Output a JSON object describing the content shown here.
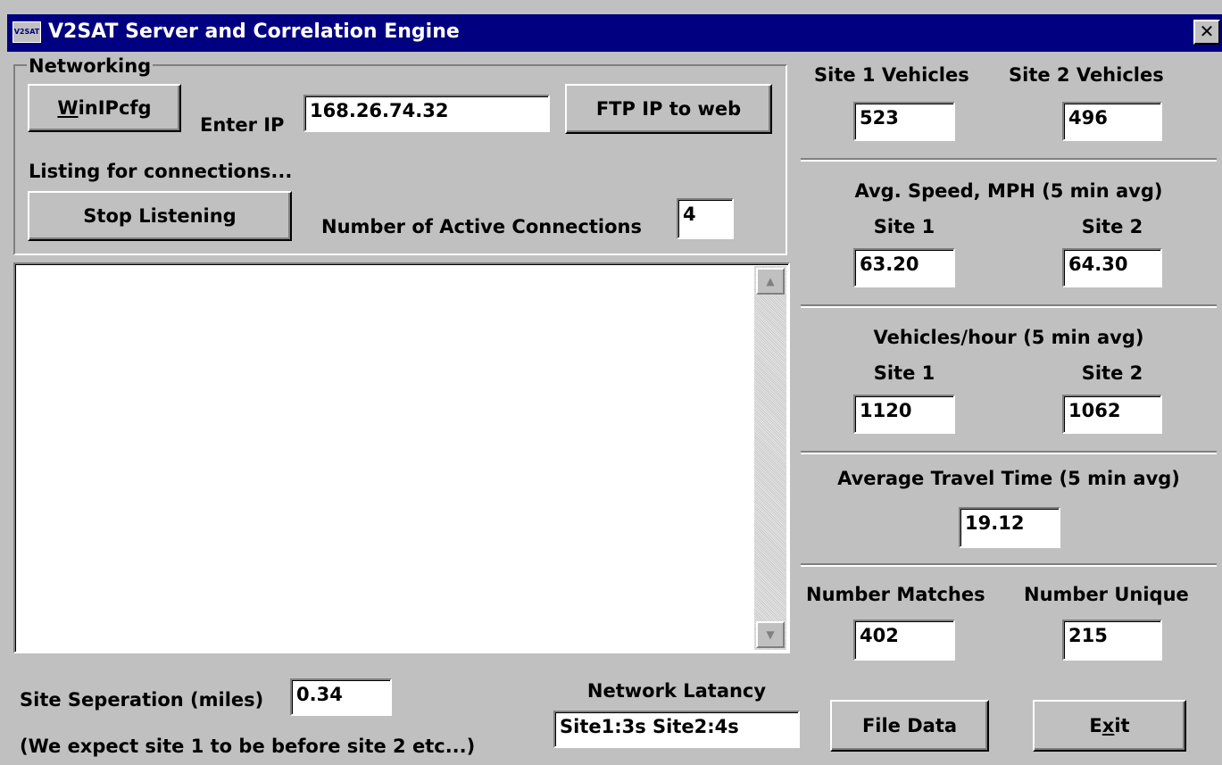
{
  "window": {
    "title": "V2SAT Server and Correlation Engine",
    "icon_label": "V2SAT",
    "close_glyph": "✕"
  },
  "networking": {
    "group_label": "Networking",
    "winipcfg_button": {
      "prefix": "",
      "mnemonic": "W",
      "suffix": "inIPcfg"
    },
    "enter_ip_label": "Enter IP",
    "ip_value": "168.26.74.32",
    "ftp_button": "FTP IP to web",
    "status_text": "Listing for connections...",
    "stop_button": "Stop Listening",
    "active_connections_label": "Number of Active Connections",
    "active_connections_value": "4"
  },
  "log": {
    "lines": []
  },
  "scrollbar": {
    "up_glyph": "▲",
    "down_glyph": "▼"
  },
  "footer": {
    "site_separation_label": "Site Seperation (miles)",
    "site_separation_value": "0.34",
    "site_order_note": "(We expect site 1 to be before site 2 etc...)",
    "network_latency_label": "Network Latancy",
    "network_latency_value": "Site1:3s Site2:4s",
    "file_data_button": "File Data",
    "exit_button": {
      "prefix": "E",
      "mnemonic": "x",
      "suffix": "it"
    }
  },
  "stats": {
    "site1_vehicles_label": "Site 1 Vehicles",
    "site2_vehicles_label": "Site 2 Vehicles",
    "site1_vehicles": "523",
    "site2_vehicles": "496",
    "avg_speed_label": "Avg. Speed, MPH (5 min avg)",
    "site1_label": "Site 1",
    "site2_label": "Site 2",
    "site1_speed": "63.20",
    "site2_speed": "64.30",
    "vph_label": "Vehicles/hour (5 min avg)",
    "site1_vph": "1120",
    "site2_vph": "1062",
    "travel_time_label": "Average Travel Time (5 min avg)",
    "travel_time": "19.12",
    "matches_label": "Number Matches",
    "unique_label": "Number Unique",
    "matches": "402",
    "unique": "215"
  },
  "colors": {
    "titlebar": "#000080",
    "face": "#c0c0c0",
    "shadow": "#808080",
    "highlight": "#ffffff"
  }
}
